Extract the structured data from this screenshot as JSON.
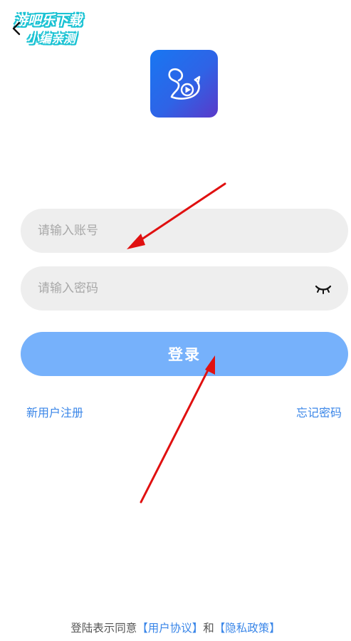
{
  "watermark": {
    "line1": "游吧乐下载",
    "line2": "小编亲测"
  },
  "header": {
    "back_icon": "chevron-left-icon"
  },
  "logo": {
    "icon": "swan-play-icon",
    "gradient": [
      "#1877f2",
      "#5a39c9"
    ]
  },
  "form": {
    "account_placeholder": "请输入账号",
    "account_value": "",
    "password_placeholder": "请输入密码",
    "password_value": "",
    "visibility_icon": "eye-closed-icon",
    "login_label": "登录"
  },
  "links": {
    "register": "新用户注册",
    "forgot": "忘记密码"
  },
  "agreement": {
    "prefix": "登陆表示同意",
    "user_agreement": "【用户协议】",
    "and": "和",
    "privacy_policy": "【隐私政策】"
  },
  "colors": {
    "accent": "#3a86e8",
    "button": "#76b1fb",
    "input_bg": "#eeeeee",
    "annotation_arrow": "#e01010"
  }
}
